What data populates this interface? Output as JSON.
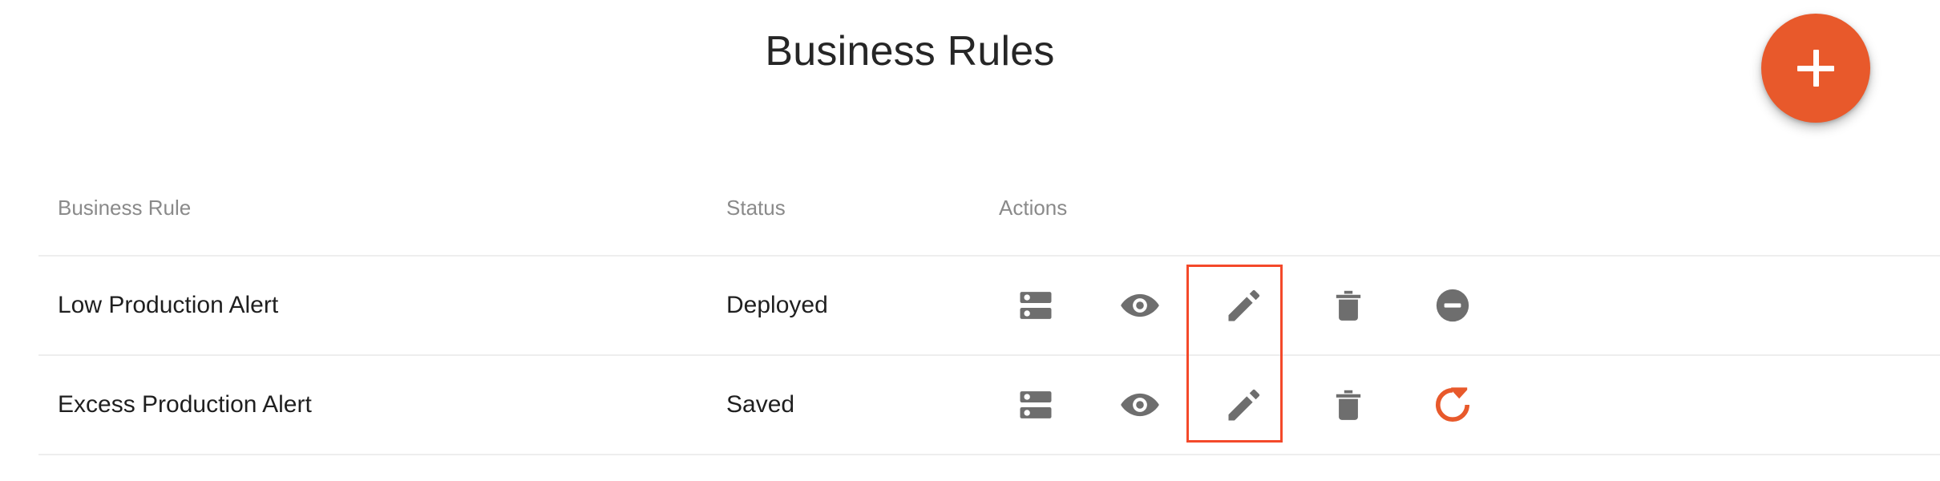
{
  "header": {
    "title": "Business Rules",
    "add_button": {
      "icon": "plus-icon",
      "label": "Add Business Rule"
    }
  },
  "theme": {
    "brand_orange": "#e8592b",
    "highlight_red": "#f4492a",
    "icon_gray": "#6e6e6e",
    "header_text_gray": "#8a8a8a",
    "body_text": "#1f1f1f",
    "divider": "#eeeeee",
    "background": "#ffffff"
  },
  "table": {
    "columns": [
      {
        "key": "rule",
        "label": "Business Rule"
      },
      {
        "key": "status",
        "label": "Status"
      },
      {
        "key": "actions",
        "label": "Actions"
      }
    ],
    "rows": [
      {
        "rule": "Low Production Alert",
        "status": "Deployed",
        "actions": [
          {
            "name": "server-icon",
            "title": "Deployment Details",
            "color": "#6e6e6e",
            "highlighted": true
          },
          {
            "name": "eye-icon",
            "title": "View",
            "color": "#6e6e6e",
            "highlighted": false
          },
          {
            "name": "pencil-icon",
            "title": "Edit",
            "color": "#6e6e6e",
            "highlighted": false
          },
          {
            "name": "trash-icon",
            "title": "Delete",
            "color": "#6e6e6e",
            "highlighted": false
          },
          {
            "name": "minus-circle-icon",
            "title": "Undeploy",
            "color": "#6e6e6e",
            "highlighted": false
          }
        ]
      },
      {
        "rule": "Excess Production Alert",
        "status": "Saved",
        "actions": [
          {
            "name": "server-icon",
            "title": "Deployment Details",
            "color": "#6e6e6e",
            "highlighted": true
          },
          {
            "name": "eye-icon",
            "title": "View",
            "color": "#6e6e6e",
            "highlighted": false
          },
          {
            "name": "pencil-icon",
            "title": "Edit",
            "color": "#6e6e6e",
            "highlighted": false
          },
          {
            "name": "trash-icon",
            "title": "Delete",
            "color": "#6e6e6e",
            "highlighted": false
          },
          {
            "name": "refresh-icon",
            "title": "Deploy",
            "color": "#e8592b",
            "highlighted": false
          }
        ]
      }
    ]
  },
  "annotation": {
    "highlight_label": "server-icon-column-highlight",
    "color": "#f4492a"
  }
}
